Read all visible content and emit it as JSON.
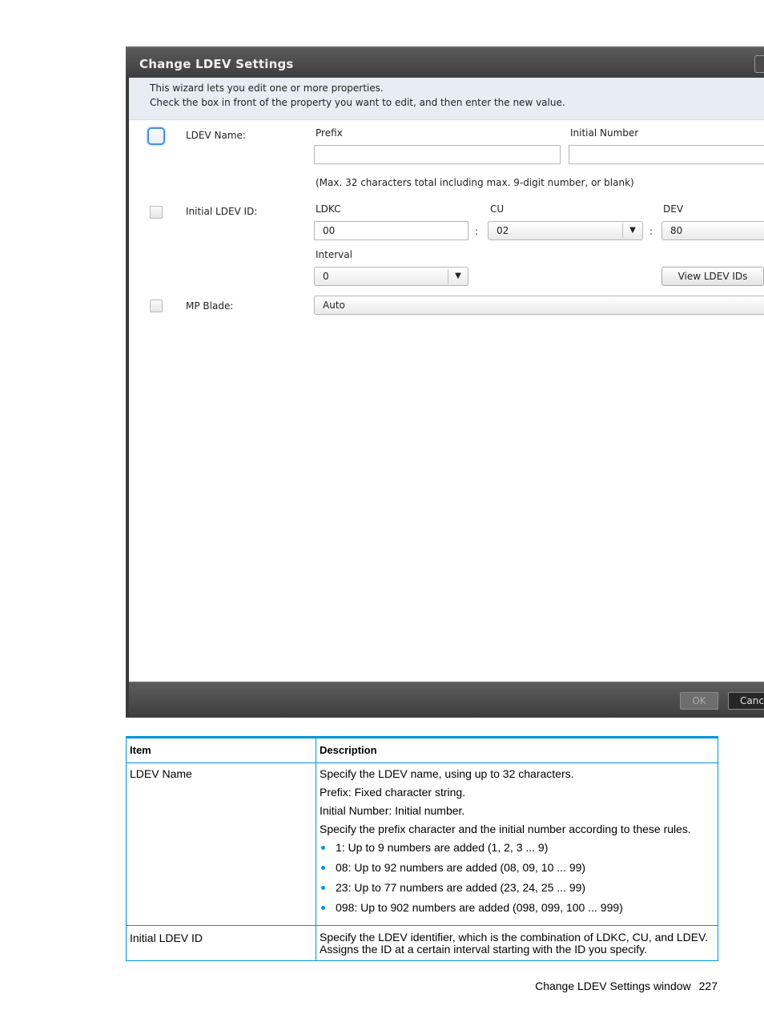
{
  "window": {
    "title": "Change LDEV Settings",
    "intro_line1": "This wizard lets you edit one or more properties.",
    "intro_line2": "Check the  box in front of the property you want to edit, and then enter the new value.",
    "ldev_name": {
      "label": "LDEV Name:",
      "prefix_label": "Prefix",
      "prefix_value": "",
      "initial_number_label": "Initial Number",
      "initial_number_value": "",
      "hint": "(Max. 32 characters total including max. 9-digit number, or blank)"
    },
    "initial_ldev_id": {
      "label": "Initial LDEV ID:",
      "ldkc_label": "LDKC",
      "ldkc_value": "00",
      "cu_label": "CU",
      "cu_value": "02",
      "dev_label": "DEV",
      "dev_value": "80",
      "separator": ":",
      "interval_label": "Interval",
      "interval_value": "0",
      "view_button": "View LDEV IDs"
    },
    "mp_blade": {
      "label": "MP Blade:",
      "value": "Auto"
    },
    "ok_button": "OK",
    "cancel_button": "Canc"
  },
  "table": {
    "headers": [
      "Item",
      "Description"
    ],
    "rows": [
      {
        "item": "LDEV Name",
        "paragraphs": [
          "Specify the LDEV name, using up to 32 characters.",
          "Prefix: Fixed character string.",
          "Initial Number: Initial number.",
          "Specify the prefix character and the initial number according to these rules."
        ],
        "bullets": [
          "1: Up to 9 numbers are added (1, 2, 3 ... 9)",
          "08: Up to 92 numbers are added (08, 09, 10 ... 99)",
          "23: Up to 77 numbers are added (23, 24, 25 ... 99)",
          "098: Up to 902 numbers are added (098, 099, 100 ... 999)"
        ]
      },
      {
        "item": "Initial LDEV ID",
        "paragraphs": [
          "Specify the LDEV identifier, which is the combination of LDKC, CU, and LDEV.",
          "Assigns the ID at a certain interval starting with the ID you specify."
        ]
      }
    ]
  },
  "footer": {
    "title": "Change LDEV Settings window",
    "page": "227"
  },
  "colors": {
    "accent": "#0096d6",
    "window_frame": "#3a3a3a",
    "intro_bg": "#e8edf3"
  }
}
